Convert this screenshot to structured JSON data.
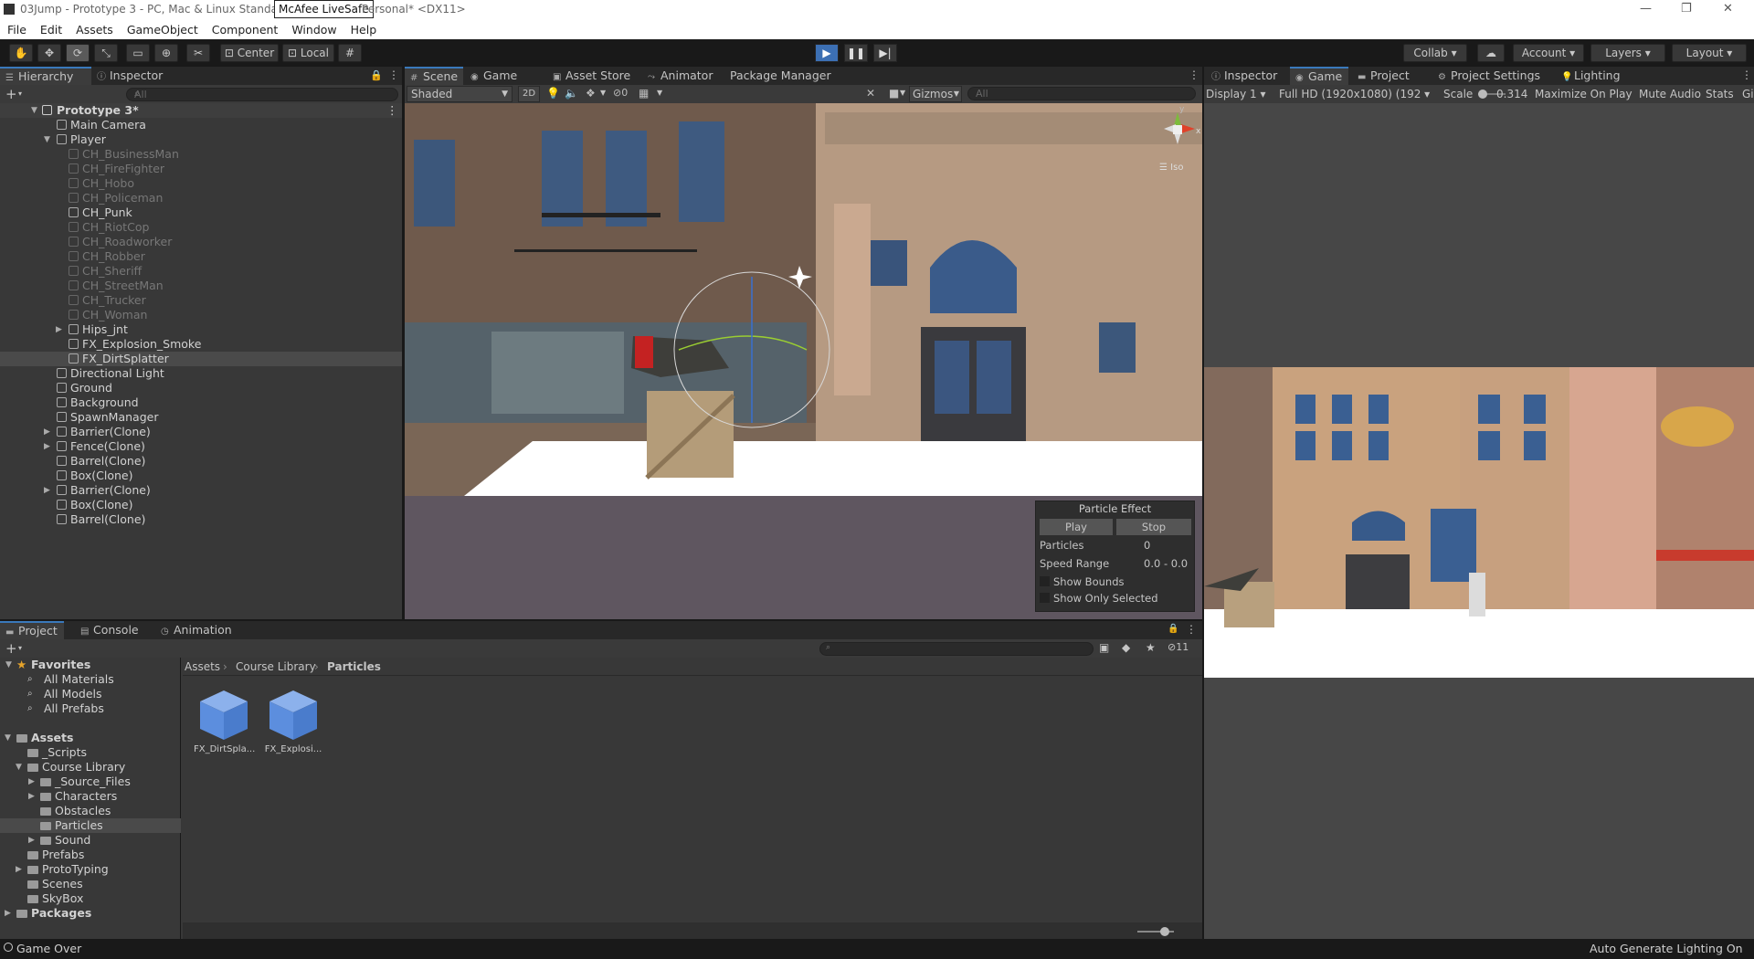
{
  "window": {
    "title": "03Jump - Prototype 3 - PC, Mac & Linux Standalone",
    "title_tail": "Personal* <DX11>",
    "tooltip": "McAfee LiveSafe"
  },
  "menu": [
    "File",
    "Edit",
    "Assets",
    "GameObject",
    "Component",
    "Window",
    "Help"
  ],
  "toolbar": {
    "center": "Center",
    "local": "Local",
    "collab": "Collab",
    "account": "Account",
    "layers": "Layers",
    "layout": "Layout"
  },
  "hierarchy": {
    "tab": "Hierarchy",
    "tab2": "Inspector",
    "search_placeholder": "All",
    "root": "Prototype 3*",
    "items": [
      {
        "label": "Main Camera",
        "indent": 1,
        "dim": false
      },
      {
        "label": "Player",
        "indent": 1,
        "dim": false,
        "expanded": true
      },
      {
        "label": "CH_BusinessMan",
        "indent": 2,
        "dim": true
      },
      {
        "label": "CH_FireFighter",
        "indent": 2,
        "dim": true
      },
      {
        "label": "CH_Hobo",
        "indent": 2,
        "dim": true
      },
      {
        "label": "CH_Policeman",
        "indent": 2,
        "dim": true
      },
      {
        "label": "CH_Punk",
        "indent": 2,
        "dim": false
      },
      {
        "label": "CH_RiotCop",
        "indent": 2,
        "dim": true
      },
      {
        "label": "CH_Roadworker",
        "indent": 2,
        "dim": true
      },
      {
        "label": "CH_Robber",
        "indent": 2,
        "dim": true
      },
      {
        "label": "CH_Sheriff",
        "indent": 2,
        "dim": true
      },
      {
        "label": "CH_StreetMan",
        "indent": 2,
        "dim": true
      },
      {
        "label": "CH_Trucker",
        "indent": 2,
        "dim": true
      },
      {
        "label": "CH_Woman",
        "indent": 2,
        "dim": true
      },
      {
        "label": "Hips_jnt",
        "indent": 2,
        "dim": false,
        "collapsed": true
      },
      {
        "label": "FX_Explosion_Smoke",
        "indent": 2,
        "dim": false
      },
      {
        "label": "FX_DirtSplatter",
        "indent": 2,
        "dim": false,
        "selected": true
      },
      {
        "label": "Directional Light",
        "indent": 1,
        "dim": false
      },
      {
        "label": "Ground",
        "indent": 1,
        "dim": false
      },
      {
        "label": "Background",
        "indent": 1,
        "dim": false
      },
      {
        "label": "SpawnManager",
        "indent": 1,
        "dim": false
      },
      {
        "label": "Barrier(Clone)",
        "indent": 1,
        "dim": false,
        "collapsed": true
      },
      {
        "label": "Fence(Clone)",
        "indent": 1,
        "dim": false,
        "collapsed": true
      },
      {
        "label": "Barrel(Clone)",
        "indent": 1,
        "dim": false
      },
      {
        "label": "Box(Clone)",
        "indent": 1,
        "dim": false
      },
      {
        "label": "Barrier(Clone)",
        "indent": 1,
        "dim": false,
        "collapsed": true
      },
      {
        "label": "Box(Clone)",
        "indent": 1,
        "dim": false
      },
      {
        "label": "Barrel(Clone)",
        "indent": 1,
        "dim": false
      }
    ]
  },
  "scene": {
    "tabs": [
      "Scene",
      "Game",
      "Asset Store",
      "Animator",
      "Package Manager"
    ],
    "shading": "Shaded",
    "mode2d": "2D",
    "hidden_count": "0",
    "gizmos": "Gizmos",
    "search_placeholder": "All",
    "iso": "Iso",
    "axis_y": "y",
    "axis_x": "x"
  },
  "particle": {
    "title": "Particle Effect",
    "play": "Play",
    "stop": "Stop",
    "particles_label": "Particles",
    "particles_value": "0",
    "speed_label": "Speed Range",
    "speed_value": "0.0 - 0.0",
    "show_bounds": "Show Bounds",
    "show_selected": "Show Only Selected"
  },
  "game": {
    "tabs": [
      "Inspector",
      "Game",
      "Project",
      "Project Settings",
      "Lighting"
    ],
    "display": "Display 1",
    "resolution": "Full HD (1920x1080) (192",
    "scale_label": "Scale",
    "scale_value": "0.314",
    "maximize": "Maximize On Play",
    "mute": "Mute Audio",
    "stats": "Stats",
    "gizmos": "Gi"
  },
  "project": {
    "tabs": [
      "Project",
      "Console",
      "Animation"
    ],
    "breadcrumb": [
      "Assets",
      "Course Library",
      "Particles"
    ],
    "hidden_count": "11",
    "favorites": {
      "label": "Favorites",
      "items": [
        "All Materials",
        "All Models",
        "All Prefabs"
      ]
    },
    "tree": [
      {
        "label": "Assets",
        "level": 0,
        "bold": true,
        "expanded": true
      },
      {
        "label": "_Scripts",
        "level": 1
      },
      {
        "label": "Course Library",
        "level": 1,
        "expanded": true
      },
      {
        "label": "_Source_Files",
        "level": 2,
        "collapsed": true
      },
      {
        "label": "Characters",
        "level": 2,
        "collapsed": true
      },
      {
        "label": "Obstacles",
        "level": 2
      },
      {
        "label": "Particles",
        "level": 2,
        "selected": true
      },
      {
        "label": "Sound",
        "level": 2,
        "collapsed": true
      },
      {
        "label": "Prefabs",
        "level": 1
      },
      {
        "label": "ProtoTyping",
        "level": 1,
        "collapsed": true
      },
      {
        "label": "Scenes",
        "level": 1
      },
      {
        "label": "SkyBox",
        "level": 1
      },
      {
        "label": "Packages",
        "level": 0,
        "bold": true,
        "collapsed": true
      }
    ],
    "assets": [
      "FX_DirtSpla...",
      "FX_Explosi..."
    ]
  },
  "status": {
    "left": "Game Over",
    "right": "Auto Generate Lighting On"
  }
}
